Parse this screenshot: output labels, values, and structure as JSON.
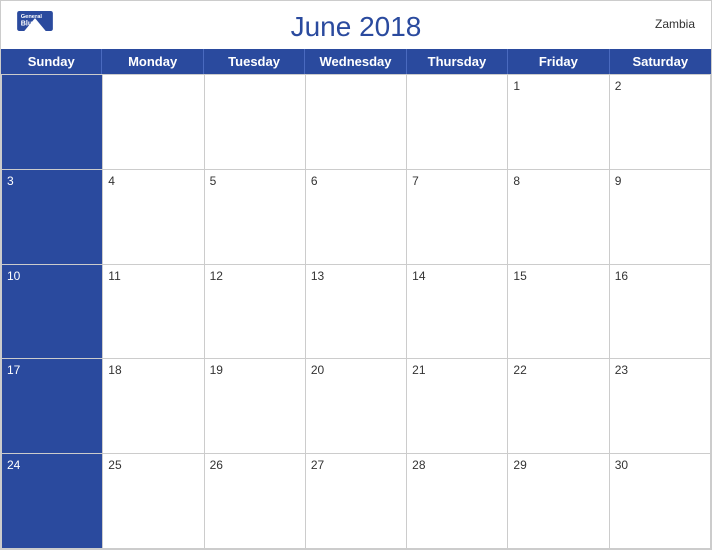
{
  "header": {
    "title": "June 2018",
    "country": "Zambia",
    "logo_general": "General",
    "logo_blue": "Blue"
  },
  "days": [
    "Sunday",
    "Monday",
    "Tuesday",
    "Wednesday",
    "Thursday",
    "Friday",
    "Saturday"
  ],
  "weeks": [
    [
      null,
      null,
      null,
      null,
      null,
      1,
      2
    ],
    [
      3,
      4,
      5,
      6,
      7,
      8,
      9
    ],
    [
      10,
      11,
      12,
      13,
      14,
      15,
      16
    ],
    [
      17,
      18,
      19,
      20,
      21,
      22,
      23
    ],
    [
      24,
      25,
      26,
      27,
      28,
      29,
      30
    ]
  ]
}
